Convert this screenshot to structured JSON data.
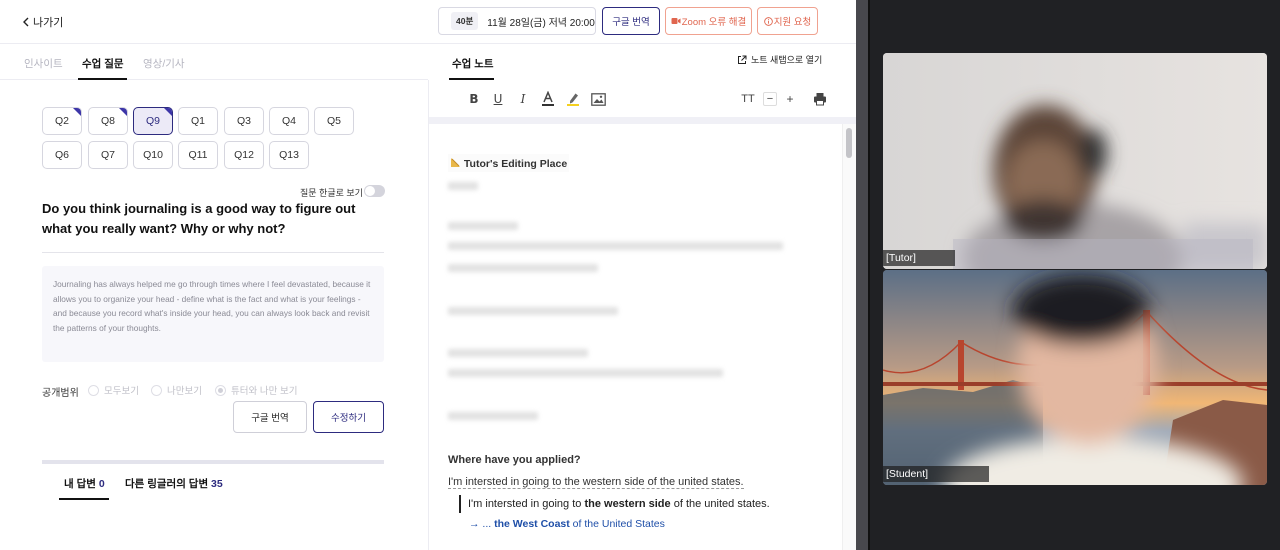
{
  "header": {
    "back_label": "나가기",
    "session_duration": "40분",
    "session_time": "11월 28일(금) 저녁 20:00",
    "translate_button": "구글 번역",
    "zoom_error_button": "Zoom 오류 해결",
    "help_button": "지원 요청"
  },
  "left_tabs": {
    "insight": "인사이트",
    "questions": "수업 질문",
    "video": "영상/기사"
  },
  "question_chips": [
    "Q2",
    "Q8",
    "Q9",
    "Q1",
    "Q3",
    "Q4",
    "Q5",
    "Q6",
    "Q7",
    "Q10",
    "Q11",
    "Q12",
    "Q13"
  ],
  "active_question": "Q9",
  "question": {
    "korean_toggle_label": "질문 한글로 보기",
    "text": "Do you think journaling is a good way to figure out what you really want? Why or why not?",
    "answer": "Journaling has always helped me go through times where I feel devastated, because it allows you to organize your head - define what is the fact and what is your feelings - and because you record what's inside your head, you can always look back and revisit the patterns of your thoughts."
  },
  "visibility": {
    "label": "공개범위",
    "options": [
      "모두보기",
      "나만보기",
      "튜터와 나만 보기"
    ],
    "selected": "튜터와 나만 보기"
  },
  "actions": {
    "translate": "구글 번역",
    "edit": "수정하기"
  },
  "answers_tabs": {
    "mine_label": "내 답변",
    "mine_count": "0",
    "others_label": "다른 링글러의 답변",
    "others_count": "35"
  },
  "note": {
    "title": "수업 노트",
    "open_new_window": "노트 새탭으로 열기",
    "tutor_place": "Tutor's Editing Place",
    "applied_question": "Where have you applied?",
    "applied_answer": "I'm intersted in going to the western side of the united states.",
    "quote_pre": "I'm intersted in going to ",
    "quote_bold": "the western side",
    "quote_post": " of the united states.",
    "correction_arrow": "→ ... ",
    "correction_bold": "the West Coast",
    "correction_post": " of the United States"
  },
  "toolbar": {
    "font_size_icon": "TT",
    "decrease": "−",
    "increase": "+"
  },
  "video": {
    "tutor_label": "[Tutor]",
    "student_label": "[Student]"
  },
  "colors": {
    "primary": "#2d2b7f",
    "alert": "#e0664f",
    "video_bg": "#202124"
  }
}
